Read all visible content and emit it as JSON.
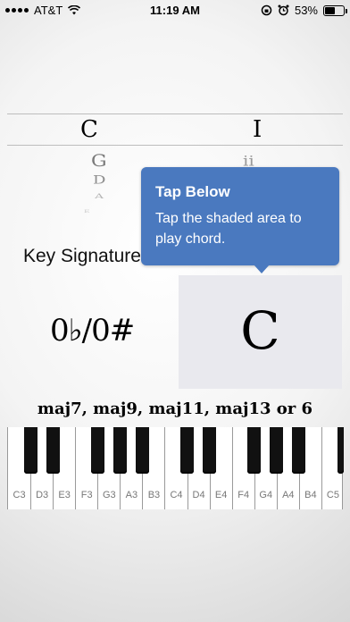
{
  "status_bar": {
    "carrier": "AT&T",
    "time": "11:19 AM",
    "battery": "53%",
    "battery_level": 0.53
  },
  "picker": {
    "note_selected": "C",
    "numeral_selected": "I",
    "note_next1": "G",
    "numeral_next1": "ii",
    "note_next2": "D",
    "note_next3": "A",
    "note_next4": "E"
  },
  "tooltip": {
    "title": "Tap Below",
    "body": "Tap the shaded area to play chord."
  },
  "key_signature": {
    "label": "Key Signature",
    "value": "0♭/0#"
  },
  "chord": {
    "name": "C"
  },
  "chord_types": "maj7, maj9, maj11, maj13 or 6",
  "keyboard": {
    "white_keys": [
      "C3",
      "D3",
      "E3",
      "F3",
      "G3",
      "A3",
      "B3",
      "C4",
      "D4",
      "E4",
      "F4",
      "G4",
      "A4",
      "B4",
      "C5"
    ],
    "black_keys": [
      "C#3",
      "D#3",
      "F#3",
      "G#3",
      "A#3",
      "C#4",
      "D#4",
      "F#4",
      "G#4",
      "A#4",
      "C#5"
    ]
  }
}
